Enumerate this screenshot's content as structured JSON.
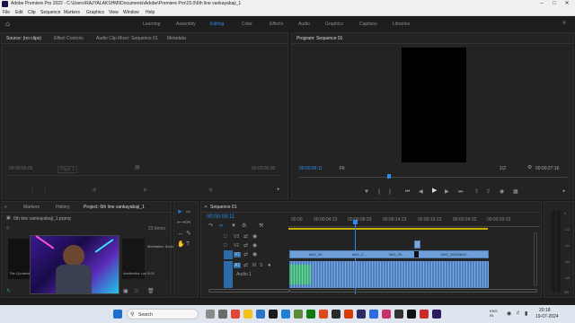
{
  "window": {
    "title": "Adobe Premiere Pro 2022 - C:\\Users\\RAJYALAKSHMI\\Documents\\Adobe\\Premiere Pro\\15.0\\6th line vankayabaji_1"
  },
  "menu": [
    "File",
    "Edit",
    "Clip",
    "Sequence",
    "Markers",
    "Graphics",
    "View",
    "Window",
    "Help"
  ],
  "workspaces": [
    {
      "label": "Learning"
    },
    {
      "label": "Assembly"
    },
    {
      "label": "Editing",
      "active": true
    },
    {
      "label": "Color"
    },
    {
      "label": "Effects"
    },
    {
      "label": "Audio"
    },
    {
      "label": "Graphics"
    },
    {
      "label": "Captions"
    },
    {
      "label": "Libraries"
    }
  ],
  "source_panel": {
    "tabs": [
      "Source: (no clips)",
      "Effect Controls",
      "Audio Clip Mixer: Sequence 01",
      "Metadata"
    ],
    "timecode_left": "00:00:00:00",
    "page": "Page 1",
    "timecode_right": "00:00:00:00"
  },
  "program_panel": {
    "tab": "Program: Sequence 01",
    "timecode_left": "00:00:09:11",
    "fit": "Fit",
    "scale": "1/2",
    "timecode_right": "00:00:27:16"
  },
  "project_panel": {
    "tabs": [
      "Markers",
      "History",
      "Project: 6th line vankayabaji_1"
    ],
    "file": "6th line vankayabaji_1.prproj",
    "items_count": "23 items",
    "thumb_labels": [
      "The Quotient...",
      "Meditation Sounds",
      "Aesthetics Lock...",
      "5:00"
    ]
  },
  "timeline": {
    "tab": "Sequence 01",
    "timecode": "00:00:09:11",
    "ruler": [
      "00:00",
      "00:00:04:23",
      "00:00:09:23",
      "00:00:14:23",
      "00:00:19:23",
      "00:00:24:23",
      "00:00:29:23"
    ],
    "video_tracks": [
      "V3",
      "V2",
      "V1"
    ],
    "audio_tracks": [
      "A1"
    ],
    "audio_label": "Audio 1",
    "clip_labels": [
      "IMG_20...",
      "IMG_2...",
      "IMG_20...",
      "IMG_20220829..."
    ]
  },
  "audio_meter": {
    "scale": [
      "0",
      "-12",
      "-24",
      "-36",
      "-48",
      "dB"
    ]
  },
  "taskbar": {
    "search": "Search",
    "language": "ENG\nIN",
    "time": "20:18",
    "date": "19-07-2024"
  },
  "colors": {
    "accent_blue": "#2d8ceb",
    "playhead": "#2d8ceb",
    "video_clip": "#6f9fd8",
    "audio_clip": "#4f7fbf",
    "audio_green": "#3fae7a"
  }
}
